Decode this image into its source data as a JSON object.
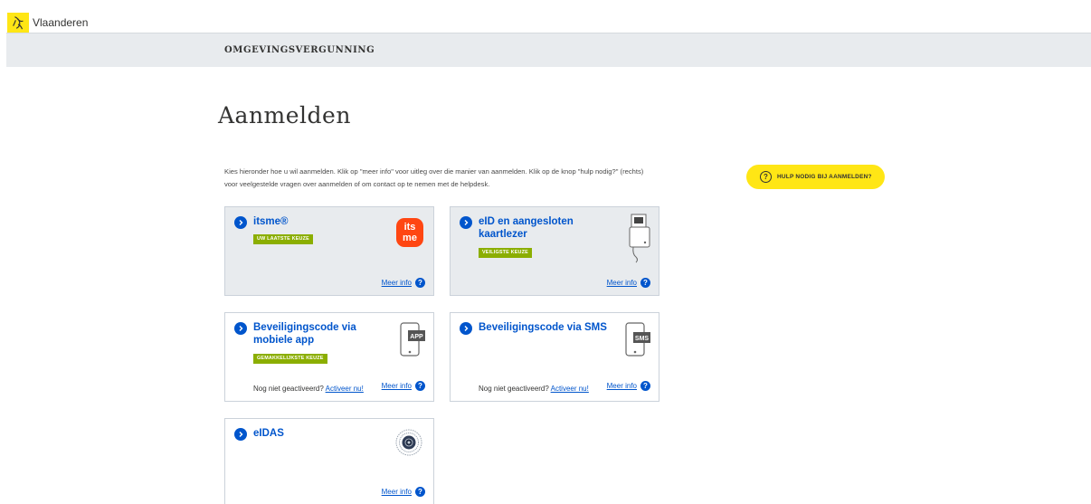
{
  "header": {
    "brand": "Vlaanderen"
  },
  "band": {
    "title": "OMGEVINGSVERGUNNING"
  },
  "page": {
    "title": "Aanmelden",
    "intro": "Kies hieronder hoe u wil aanmelden. Klik op \"meer info\" voor uitleg over die manier van aanmelden. Klik op de knop \"hulp nodig?\" (rechts) voor veelgestelde vragen over aanmelden of om contact op te nemen met de helpdesk."
  },
  "help": {
    "icon": "?",
    "label": "HULP NODIG BIJ AANMELDEN?"
  },
  "cards": {
    "itsme": {
      "title": "itsme®",
      "tag": "UW LAATSTE KEUZE",
      "logo_text_top": "its",
      "logo_text_bottom": "me",
      "more": "Meer info"
    },
    "eid": {
      "title": "eID en aangesloten kaartlezer",
      "tag": "VEILIGSTE KEUZE",
      "more": "Meer info"
    },
    "app": {
      "title": "Beveiligingscode via mobiele app",
      "tag": "GEMAKKELIJKSTE KEUZE",
      "icon_label": "APP",
      "not_activated": "Nog niet geactiveerd?",
      "activate": "Activeer nu!",
      "more": "Meer info"
    },
    "sms": {
      "title": "Beveiligingscode via SMS",
      "icon_label": "SMS",
      "not_activated": "Nog niet geactiveerd?",
      "activate": "Activeer nu!",
      "more": "Meer info"
    },
    "eidas": {
      "title": "eIDAS",
      "more": "Meer info"
    }
  },
  "colors": {
    "accent_blue": "#0055cc",
    "brand_yellow": "#ffe615",
    "tag_green": "#8bae00",
    "itsme_red": "#ff4612"
  }
}
